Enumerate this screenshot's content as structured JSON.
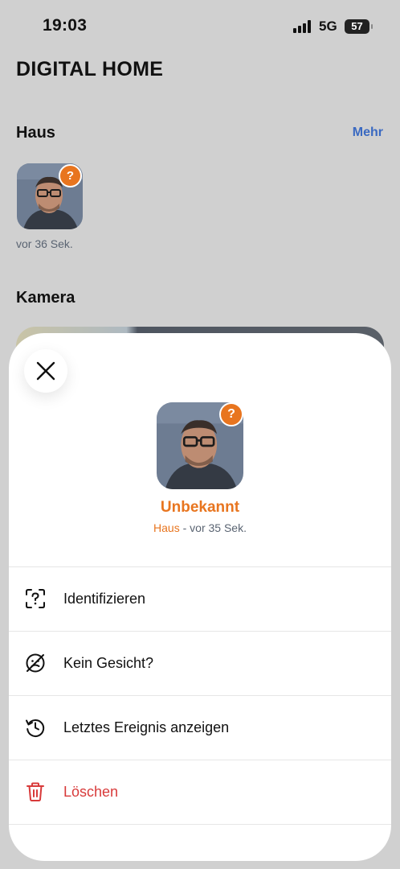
{
  "status_bar": {
    "time": "19:03",
    "network": "5G",
    "battery": "57"
  },
  "app": {
    "title": "DIGITAL HOME"
  },
  "haus_section": {
    "title": "Haus",
    "more_label": "Mehr",
    "thumb_badge": "?",
    "thumb_time": "vor 36 Sek."
  },
  "camera_section": {
    "title": "Kamera"
  },
  "sheet": {
    "badge": "?",
    "name": "Unbekannt",
    "location": "Haus",
    "separator": " - ",
    "time": "vor 35 Sek.",
    "actions": [
      {
        "label": "Identifizieren",
        "icon": "face-scan-question-icon"
      },
      {
        "label": "Kein Gesicht?",
        "icon": "face-slash-icon"
      },
      {
        "label": "Letztes Ereignis anzeigen",
        "icon": "history-icon"
      },
      {
        "label": "Löschen",
        "icon": "trash-icon"
      }
    ]
  },
  "colors": {
    "accent": "#e8751f",
    "link": "#3a69c1",
    "danger": "#d83a3a",
    "backdrop": "#d0d0d0"
  }
}
